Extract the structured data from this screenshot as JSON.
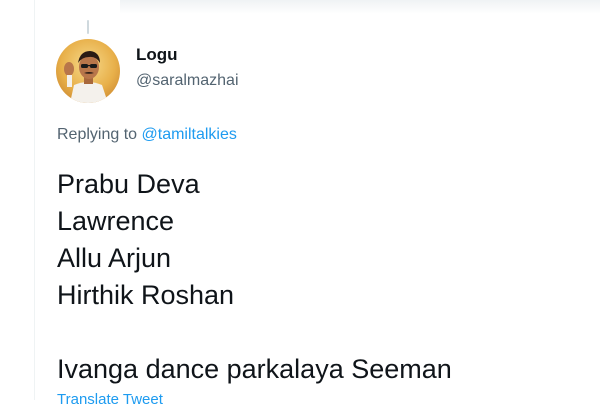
{
  "user": {
    "display_name": "Logu",
    "handle": "@saralmazhai"
  },
  "reply_context": {
    "prefix": "Replying to",
    "mention": "@tamiltalkies"
  },
  "tweet": {
    "lines": [
      "Prabu Deva",
      "Lawrence",
      "Allu Arjun",
      "Hirthik Roshan"
    ],
    "closing_line": "Ivanga dance parkalaya Seeman"
  },
  "actions": {
    "translate_label": "Translate Tweet"
  },
  "colors": {
    "link": "#1d9bf0",
    "secondary_text": "#536471",
    "primary_text": "#0f1419"
  }
}
